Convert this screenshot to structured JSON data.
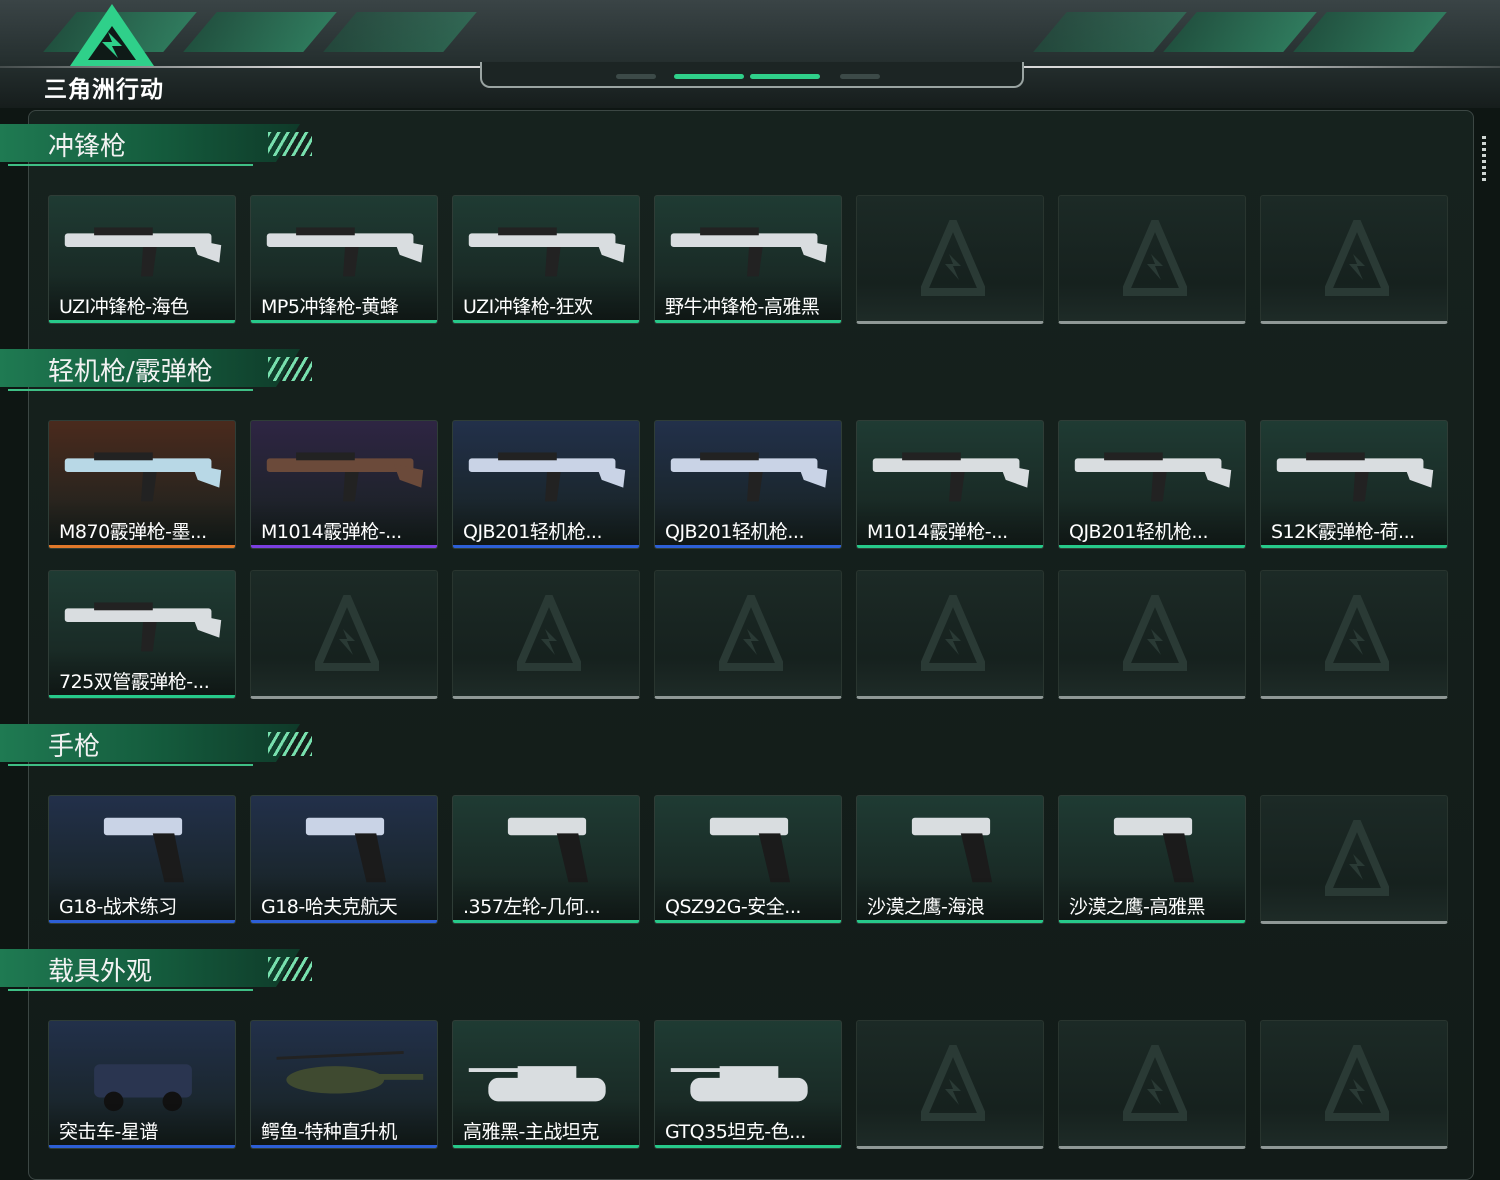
{
  "game_title": "三角洲行动",
  "colors": {
    "accent": "#2fbf7e",
    "rarity_green": "#27c98a",
    "rarity_blue": "#2d5fd6",
    "rarity_purple": "#7b3fe0",
    "rarity_orange": "#e0782a",
    "empty_slot": "#8f9896"
  },
  "sections": [
    {
      "title": "冲锋枪",
      "items": [
        {
          "label": "UZI冲锋枪-海色",
          "rarity": "green",
          "bg": "#1f3b33",
          "icon": "uzi-smg-icon"
        },
        {
          "label": "MP5冲锋枪-黄蜂",
          "rarity": "green",
          "bg": "#1f3b33",
          "icon": "mp5-smg-icon"
        },
        {
          "label": "UZI冲锋枪-狂欢",
          "rarity": "green",
          "bg": "#1f3b33",
          "icon": "uzi-smg-icon"
        },
        {
          "label": "野牛冲锋枪-高雅黑",
          "rarity": "green",
          "bg": "#1f3b33",
          "icon": "bizon-smg-icon"
        },
        {
          "empty": true
        },
        {
          "empty": true
        },
        {
          "empty": true
        }
      ]
    },
    {
      "title": "轻机枪/霰弹枪",
      "items": [
        {
          "label": "M870霰弹枪-墨...",
          "rarity": "orange",
          "bg": "#4a2a1d",
          "icon": "shotgun-icon"
        },
        {
          "label": "M1014霰弹枪-...",
          "rarity": "purple",
          "bg": "#2e2543",
          "icon": "shotgun-icon"
        },
        {
          "label": "QJB201轻机枪...",
          "rarity": "blue",
          "bg": "#22304a",
          "icon": "lmg-icon"
        },
        {
          "label": "QJB201轻机枪...",
          "rarity": "blue",
          "bg": "#22304a",
          "icon": "lmg-icon"
        },
        {
          "label": "M1014霰弹枪-...",
          "rarity": "green",
          "bg": "#1f3b33",
          "icon": "shotgun-icon"
        },
        {
          "label": "QJB201轻机枪...",
          "rarity": "green",
          "bg": "#1f3b33",
          "icon": "lmg-icon"
        },
        {
          "label": "S12K霰弹枪-荷...",
          "rarity": "green",
          "bg": "#1f3b33",
          "icon": "s12k-shotgun-icon"
        },
        {
          "label": "725双管霰弹枪-...",
          "rarity": "green",
          "bg": "#1f3b33",
          "icon": "double-barrel-shotgun-icon"
        },
        {
          "empty": true
        },
        {
          "empty": true
        },
        {
          "empty": true
        },
        {
          "empty": true
        },
        {
          "empty": true
        },
        {
          "empty": true
        }
      ]
    },
    {
      "title": "手枪",
      "items": [
        {
          "label": "G18-战术练习",
          "rarity": "blue",
          "bg": "#22304a",
          "icon": "pistol-icon"
        },
        {
          "label": "G18-哈夫克航天",
          "rarity": "blue",
          "bg": "#22304a",
          "icon": "pistol-icon"
        },
        {
          "label": ".357左轮-几何...",
          "rarity": "green",
          "bg": "#1f3b33",
          "icon": "revolver-icon"
        },
        {
          "label": "QSZ92G-安全...",
          "rarity": "green",
          "bg": "#1f3b33",
          "icon": "pistol-icon"
        },
        {
          "label": "沙漠之鹰-海浪",
          "rarity": "green",
          "bg": "#1f3b33",
          "icon": "desert-eagle-icon"
        },
        {
          "label": "沙漠之鹰-高雅黑",
          "rarity": "green",
          "bg": "#1f3b33",
          "icon": "desert-eagle-icon"
        },
        {
          "empty": true
        }
      ]
    },
    {
      "title": "载具外观",
      "items": [
        {
          "label": "突击车-星谱",
          "rarity": "blue",
          "bg": "#22304a",
          "icon": "assault-vehicle-icon"
        },
        {
          "label": "鳄鱼-特种直升机",
          "rarity": "blue",
          "bg": "#22304a",
          "icon": "helicopter-icon"
        },
        {
          "label": "高雅黑-主战坦克",
          "rarity": "green",
          "bg": "#1f3b33",
          "icon": "tank-icon"
        },
        {
          "label": "GTQ35坦克-色...",
          "rarity": "green",
          "bg": "#1f3b33",
          "icon": "tank-icon"
        },
        {
          "empty": true
        },
        {
          "empty": true
        },
        {
          "empty": true
        }
      ]
    }
  ]
}
